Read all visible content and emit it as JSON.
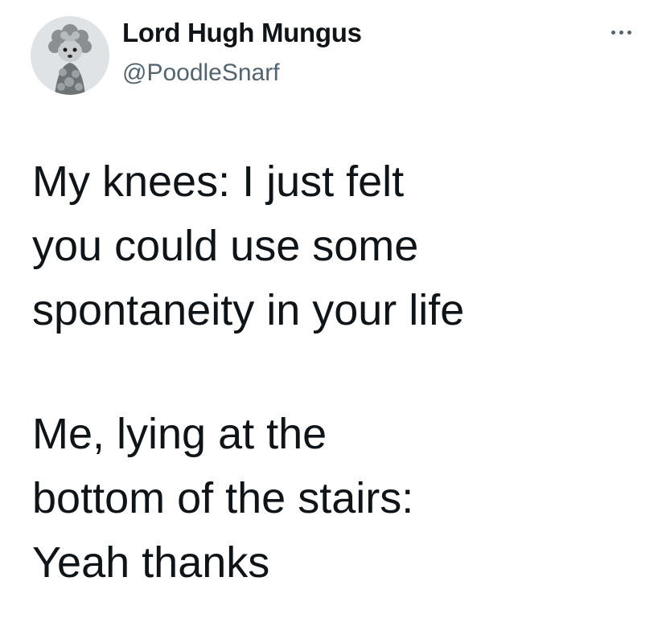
{
  "tweet": {
    "author": {
      "display_name": "Lord Hugh Mungus",
      "handle": "@PoodleSnarf",
      "avatar": "poodle-avatar"
    },
    "more_icon": "more-horizontal-icon",
    "paragraphs": [
      {
        "lines": [
          "My knees: I just felt",
          "you could use some",
          "spontaneity in your life"
        ]
      },
      {
        "lines": [
          "Me, lying at the",
          "bottom of the stairs:",
          "Yeah thanks"
        ]
      }
    ]
  },
  "colors": {
    "text": "#0f1419",
    "secondary": "#536471",
    "background": "#ffffff"
  }
}
